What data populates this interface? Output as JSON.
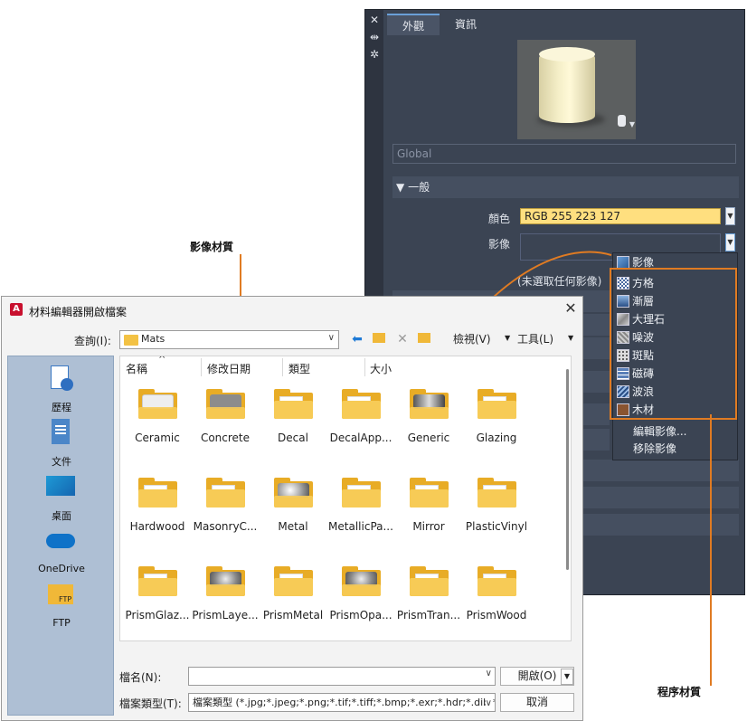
{
  "material_panel": {
    "side_icons": [
      "close-icon",
      "pin-icon",
      "settings-icon"
    ],
    "tabs": [
      "外觀",
      "資訊"
    ],
    "material_name": "Global",
    "section_general": "一般",
    "color_label": "顏色",
    "color_value": "RGB 255 223 127",
    "color_hex": "#FFDF7F",
    "image_label": "影像",
    "no_image_text": "(未選取任何影像)"
  },
  "image_menu": {
    "items": [
      {
        "label": "影像",
        "icon": "image-icon"
      },
      {
        "label": "方格",
        "icon": "checker-icon"
      },
      {
        "label": "漸層",
        "icon": "gradient-icon"
      },
      {
        "label": "大理石",
        "icon": "marble-icon"
      },
      {
        "label": "噪波",
        "icon": "noise-icon"
      },
      {
        "label": "斑點",
        "icon": "speckle-icon"
      },
      {
        "label": "磁磚",
        "icon": "tiles-icon"
      },
      {
        "label": "波浪",
        "icon": "waves-icon"
      },
      {
        "label": "木材",
        "icon": "wood-icon"
      },
      {
        "label": "編輯影像..."
      },
      {
        "label": "移除影像"
      }
    ]
  },
  "callouts": {
    "image_material": "影像材質",
    "procedural_material": "程序材質"
  },
  "dialog": {
    "title": "材料編輯器開啟檔案",
    "look_in_label": "查詢(I):",
    "look_in_value": "Mats",
    "views_label": "檢視(V)",
    "tools_label": "工具(L)",
    "places": [
      {
        "label": "歷程",
        "icon": "history-icon"
      },
      {
        "label": "文件",
        "icon": "documents-icon"
      },
      {
        "label": "桌面",
        "icon": "desktop-icon"
      },
      {
        "label": "OneDrive",
        "icon": "onedrive-icon"
      },
      {
        "label": "FTP",
        "icon": "ftp-folder-icon"
      }
    ],
    "columns": [
      "名稱",
      "修改日期",
      "類型",
      "大小"
    ],
    "files": [
      "Ceramic",
      "Concrete",
      "Decal",
      "DecalApp...",
      "Generic",
      "Glazing",
      "Hardwood",
      "MasonryC...",
      "Metal",
      "MetallicPa...",
      "Mirror",
      "PlasticVinyl",
      "PrismGlaz...",
      "PrismLaye...",
      "PrismMetal",
      "PrismOpa...",
      "PrismTran...",
      "PrismWood"
    ],
    "file_name_label": "檔名(N):",
    "file_name_value": "",
    "file_type_label": "檔案類型(T):",
    "file_type_value": "檔案類型  (*.jpg;*.jpeg;*.png;*.tif;*.tiff;*.bmp;*.exr;*.hdr;*.dib;*",
    "open_button": "開啟(O)",
    "cancel_button": "取消"
  }
}
